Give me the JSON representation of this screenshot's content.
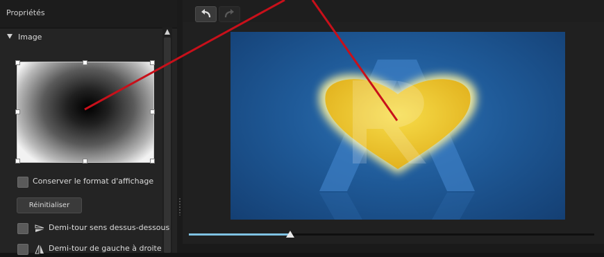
{
  "properties_panel": {
    "title": "Propriétés",
    "section_label": "Image",
    "keep_aspect_label": "Conserver le format d'affichage",
    "reset_label": "Réinitialiser",
    "flip_vertical_label": "Demi-tour sens dessus-dessous",
    "flip_horizontal_label": "Demi-tour de gauche à droite"
  },
  "toolbar": {
    "undo_icon": "undo-icon",
    "redo_icon": "redo-icon"
  },
  "timeline": {
    "position": 0.25
  },
  "colors": {
    "accent": "#7fc3e3",
    "annotation_line": "#c8101a",
    "heart_fill": "#f2d23c"
  }
}
